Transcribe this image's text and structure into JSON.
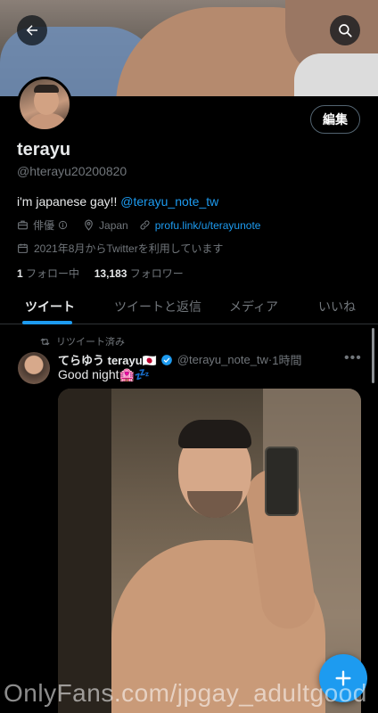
{
  "profile": {
    "display_name": "terayu",
    "handle": "@hterayu20200820",
    "bio_text": "i'm japanese gay!!",
    "bio_mention": "@terayu_note_tw",
    "occupation": "俳優",
    "location": "Japan",
    "website": "profu.link/u/terayunote",
    "joined": "2021年8月からTwitterを利用しています",
    "following_count": "1",
    "following_label": "フォロー中",
    "followers_count": "13,183",
    "followers_label": "フォロワー",
    "edit_label": "編集"
  },
  "tabs": [
    {
      "label": "ツイート",
      "active": true
    },
    {
      "label": "ツイートと返信",
      "active": false
    },
    {
      "label": "メディア",
      "active": false
    },
    {
      "label": "いいね",
      "active": false
    }
  ],
  "tweet": {
    "retweet_label": "リツイート済み",
    "author_name": "てらゆう terayu🇯🇵",
    "author_handle": "@terayu_note_tw",
    "separator": "·",
    "time": "1時間",
    "text": "Good night🏩💤"
  },
  "watermark": "OnlyFans.com/jpgay_adultgood",
  "colors": {
    "accent": "#1d9bf0",
    "background": "#000000",
    "secondary_text": "#71767b"
  },
  "icons": [
    "back-arrow-icon",
    "search-icon",
    "briefcase-icon",
    "location-pin-icon",
    "link-icon",
    "calendar-icon",
    "retweet-icon",
    "verified-badge-icon",
    "more-icon",
    "compose-plus-icon"
  ]
}
